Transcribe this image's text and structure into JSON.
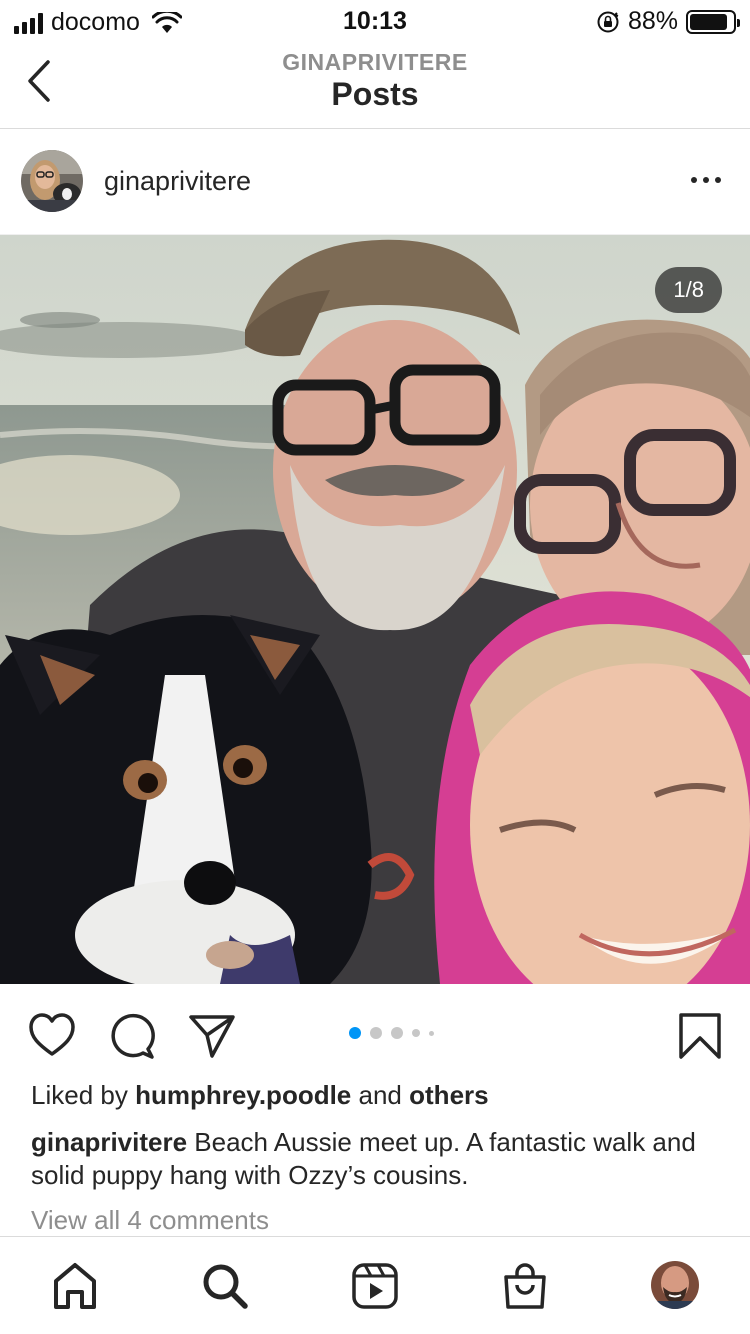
{
  "status_bar": {
    "carrier": "docomo",
    "time": "10:13",
    "battery": "88%",
    "battery_level": 0.88,
    "icons": [
      "signal-bars-icon",
      "wifi-icon",
      "rotation-lock-icon",
      "battery-icon"
    ]
  },
  "header": {
    "subtitle": "GINAPRIVITERE",
    "title": "Posts",
    "back_icon": "chevron-left-icon"
  },
  "post": {
    "username": "ginaprivitere",
    "more_icon": "more-horizontal-icon",
    "image_counter": "1/8",
    "carousel": {
      "total_dots_shown": 5,
      "active_index": 0
    },
    "liked_by_prefix": "Liked by",
    "liked_by_user": "humphrey.poodle",
    "liked_by_and": "and",
    "liked_by_others": "others",
    "caption_user": "ginaprivitere",
    "caption_text": " Beach Aussie meet up. A fantastic walk and solid puppy hang with Ozzy’s cousins.",
    "view_comments": "View all 4 comments",
    "action_icons": [
      "heart-icon",
      "comment-icon",
      "share-icon",
      "bookmark-icon"
    ]
  },
  "tab_bar": {
    "items": [
      "home-icon",
      "search-icon",
      "reels-icon",
      "shop-icon",
      "profile-avatar"
    ]
  },
  "colors": {
    "text": "#262626",
    "muted": "#8e8e8e",
    "accent_dot": "#0095f6",
    "divider": "#dbdbdb"
  }
}
